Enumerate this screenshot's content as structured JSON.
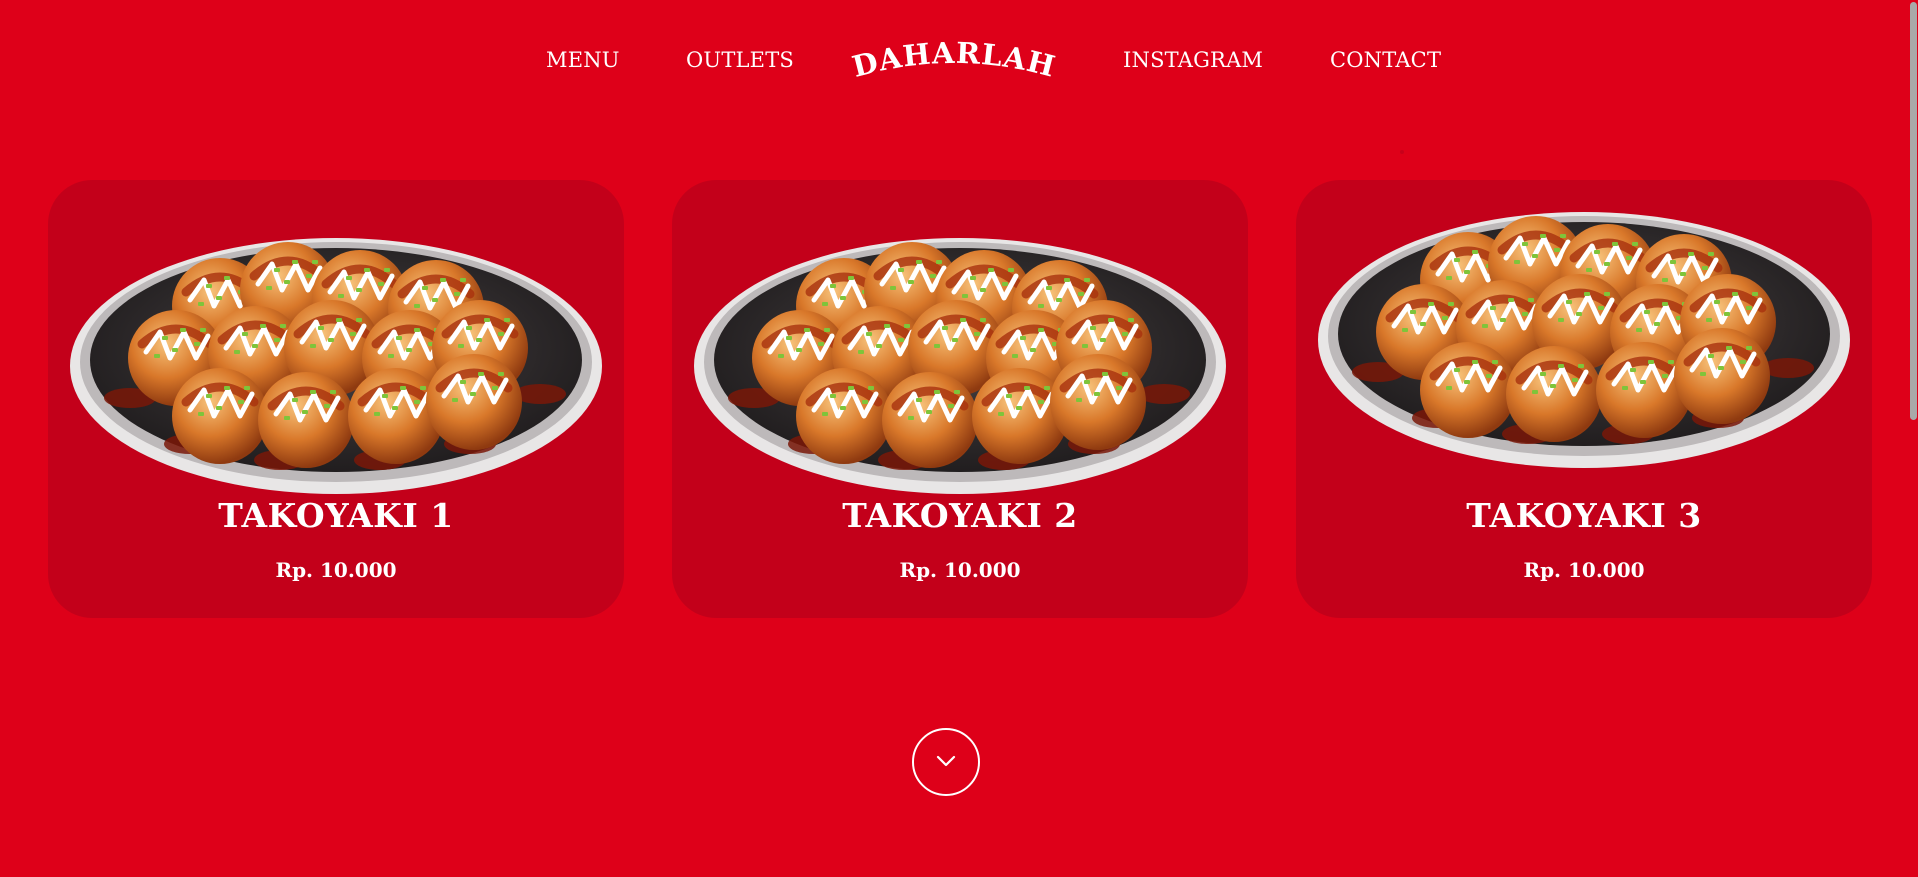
{
  "nav": {
    "menu_label": "MENU",
    "outlets_label": "OUTLETS",
    "logo_text": "DAHARLAH",
    "instagram_label": "INSTAGRAM",
    "contact_label": "CONTACT"
  },
  "products": [
    {
      "name": "TAKOYAKI 1",
      "price": "Rp. 10.000"
    },
    {
      "name": "TAKOYAKI 2",
      "price": "Rp. 10.000"
    },
    {
      "name": "TAKOYAKI 3",
      "price": "Rp. 10.000"
    }
  ],
  "scroll_icon": "chevron-down-icon",
  "colors": {
    "background": "#de0019",
    "card": "#c3001a",
    "text": "#ffffff",
    "scrollbar_thumb": "#a9a9a9"
  }
}
